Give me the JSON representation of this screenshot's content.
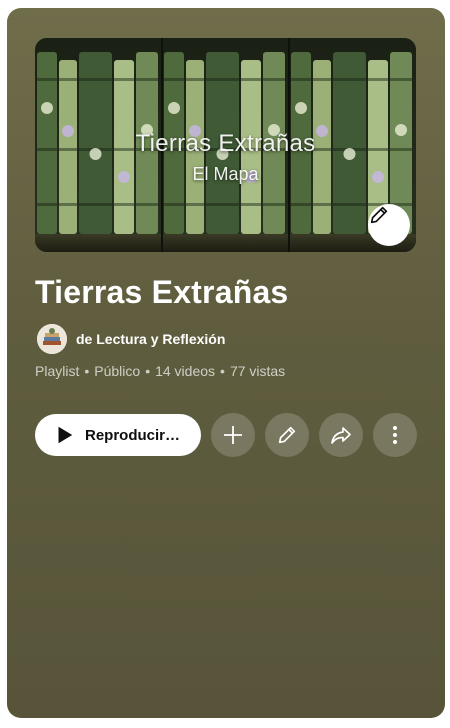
{
  "playlist": {
    "thumbnail_title": "Tierras Extrañas",
    "thumbnail_subtitle": "El Mapa",
    "title": "Tierras Extrañas",
    "owner": "de Lectura y Reflexión",
    "meta": {
      "type": "Playlist",
      "visibility": "Público",
      "videos": "14 videos",
      "views": "77 vistas",
      "separator": "•"
    }
  },
  "actions": {
    "play_label": "Reproducir…",
    "icons": [
      "play-icon",
      "plus-icon",
      "pencil-icon",
      "share-icon",
      "more-vert-icon"
    ]
  },
  "colors": {
    "card_background": "#5f5d3e",
    "button_light": "#ffffff",
    "text_primary": "#ffffff"
  }
}
